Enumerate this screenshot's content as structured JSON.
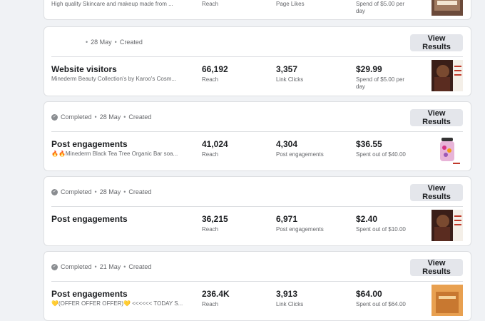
{
  "top_card": {
    "subtitle": "High quality Skincare and makeup made from ...",
    "metric1_label": "Reach",
    "metric2_label": "Page Likes",
    "metric3_label": "Spend of $5.00 per day"
  },
  "cards": [
    {
      "status": "",
      "date": "28 May",
      "created": "Created",
      "button": "View Results",
      "title": "Website visitors",
      "subtitle": "Minederm Beauty Collection's by Karoo's Cosm...",
      "metric1_value": "66,192",
      "metric1_label": "Reach",
      "metric2_value": "3,357",
      "metric2_label": "Link Clicks",
      "metric3_value": "$29.99",
      "metric3_label": "Spend of $5.00 per day",
      "thumb": "portrait-dark-red"
    },
    {
      "status": "Completed",
      "date": "28 May",
      "created": "Created",
      "button": "View Results",
      "title": "Post engagements",
      "subtitle": "🔥🔥Minederm Black Tea Tree Organic Bar soa...",
      "metric1_value": "41,024",
      "metric1_label": "Reach",
      "metric2_value": "4,304",
      "metric2_label": "Post engagements",
      "metric3_value": "$36.55",
      "metric3_label": "Spent out of $40.00",
      "thumb": "jar-product"
    },
    {
      "status": "Completed",
      "date": "28 May",
      "created": "Created",
      "button": "View Results",
      "title": "Post engagements",
      "subtitle": "",
      "metric1_value": "36,215",
      "metric1_label": "Reach",
      "metric2_value": "6,971",
      "metric2_label": "Post engagements",
      "metric3_value": "$2.40",
      "metric3_label": "Spent out of $10.00",
      "thumb": "portrait-dark-red"
    },
    {
      "status": "Completed",
      "date": "21 May",
      "created": "Created",
      "button": "View Results",
      "title": "Post engagements",
      "subtitle": "💛(OFFER OFFER OFFER)💛 <<<<<< TODAY S...",
      "metric1_value": "236.4K",
      "metric1_label": "Reach",
      "metric2_value": "3,913",
      "metric2_label": "Link Clicks",
      "metric3_value": "$64.00",
      "metric3_label": "Spent out of $64.00",
      "thumb": "orange-box"
    }
  ],
  "colors": {
    "background": "#f0f2f5",
    "card": "#ffffff",
    "button": "#e4e6eb",
    "secondary_text": "#65676b"
  }
}
